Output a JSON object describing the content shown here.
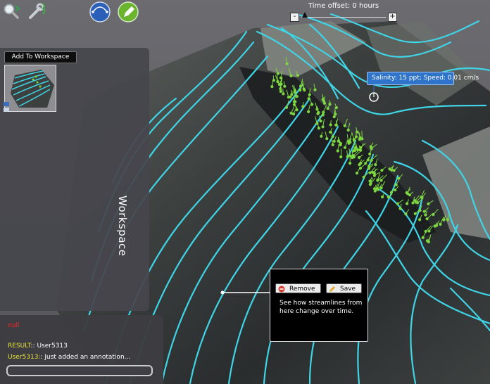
{
  "toolbar": {
    "icons": [
      "search-icon",
      "settings-wrench-icon",
      "globe-icon",
      "draw-pen-icon"
    ]
  },
  "time": {
    "label": "Time offset: 0 hours",
    "minus": "-",
    "plus": "+"
  },
  "workspace": {
    "add_button": "Add To Workspace",
    "title": "Workspace"
  },
  "console": {
    "null_text": "null",
    "result_key": "RESULT",
    "result_sep": ":: ",
    "result_value": "User5313",
    "user_key": "User5313:",
    "user_sep": ": ",
    "user_message": "Just added an annotation...",
    "input_value": ""
  },
  "annotation": {
    "remove_label": "Remove",
    "save_label": "Save",
    "text": "See how streamlines from here change over time."
  },
  "tooltip": {
    "text": "Salinity: 15 ppt; Speed: 0.01 cm/s"
  },
  "colors": {
    "streamline": "#3fd4e6",
    "vector": "#7ed640",
    "tooltip": "#2f74c9",
    "error": "#ff2222",
    "console_key": "#e8e23a"
  }
}
